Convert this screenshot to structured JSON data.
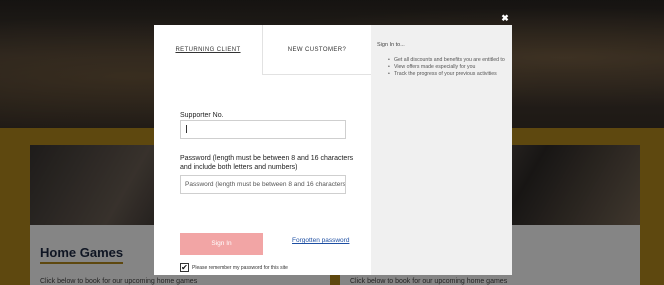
{
  "background": {
    "left_card": {
      "title": "Home Games",
      "text": "Click below to book for our upcoming home games"
    },
    "right_card": {
      "text": "Click below to book for our upcoming home games"
    }
  },
  "modal": {
    "close_label": "✖",
    "tabs": {
      "returning": "RETURNING CLIENT",
      "new": "NEW CUSTOMER?"
    },
    "supporter": {
      "label": "Supporter No.",
      "value": ""
    },
    "password": {
      "label": "Password (length must be between 8 and 16 characters and include both letters and numbers)",
      "placeholder": "Password (length must be between 8 and 16 characters and include both letters and numbers)"
    },
    "signin_label": "Sign In",
    "forgot_label": "Forgotten password",
    "remember": {
      "checked": true,
      "check_mark": "✔",
      "label": "Please remember my password for this site"
    },
    "side": {
      "title": "Sign In to...",
      "items": [
        "Get all discounts and benefits you are entitled to",
        "View offers made especially for you",
        "Track the progress of your previous activities"
      ]
    }
  }
}
